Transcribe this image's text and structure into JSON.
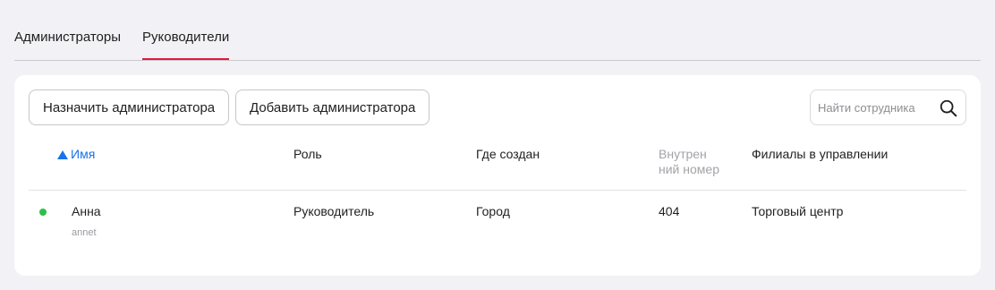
{
  "tabs": [
    {
      "label": "Администраторы",
      "active": false
    },
    {
      "label": "Руководители",
      "active": true
    }
  ],
  "toolbar": {
    "assign_label": "Назначить администратора",
    "add_label": "Добавить администратора",
    "search_placeholder": "Найти сотрудника",
    "search_value": ""
  },
  "table": {
    "sort": {
      "column": "name",
      "direction": "asc"
    },
    "columns": {
      "name": "Имя",
      "role": "Роль",
      "created": "Где создан",
      "ext_line1": "Внутрен",
      "ext_line2": "ний номер",
      "branches": "Филиалы в управлении"
    },
    "rows": [
      {
        "status": "online",
        "name": "Анна",
        "login": "annet",
        "role": "Руководитель",
        "created": "Город",
        "ext": "404",
        "branches": "Торговый центр"
      }
    ]
  },
  "colors": {
    "accent_red": "#e4173a",
    "sort_blue": "#1a73e8",
    "status_green": "#2fbf45"
  }
}
